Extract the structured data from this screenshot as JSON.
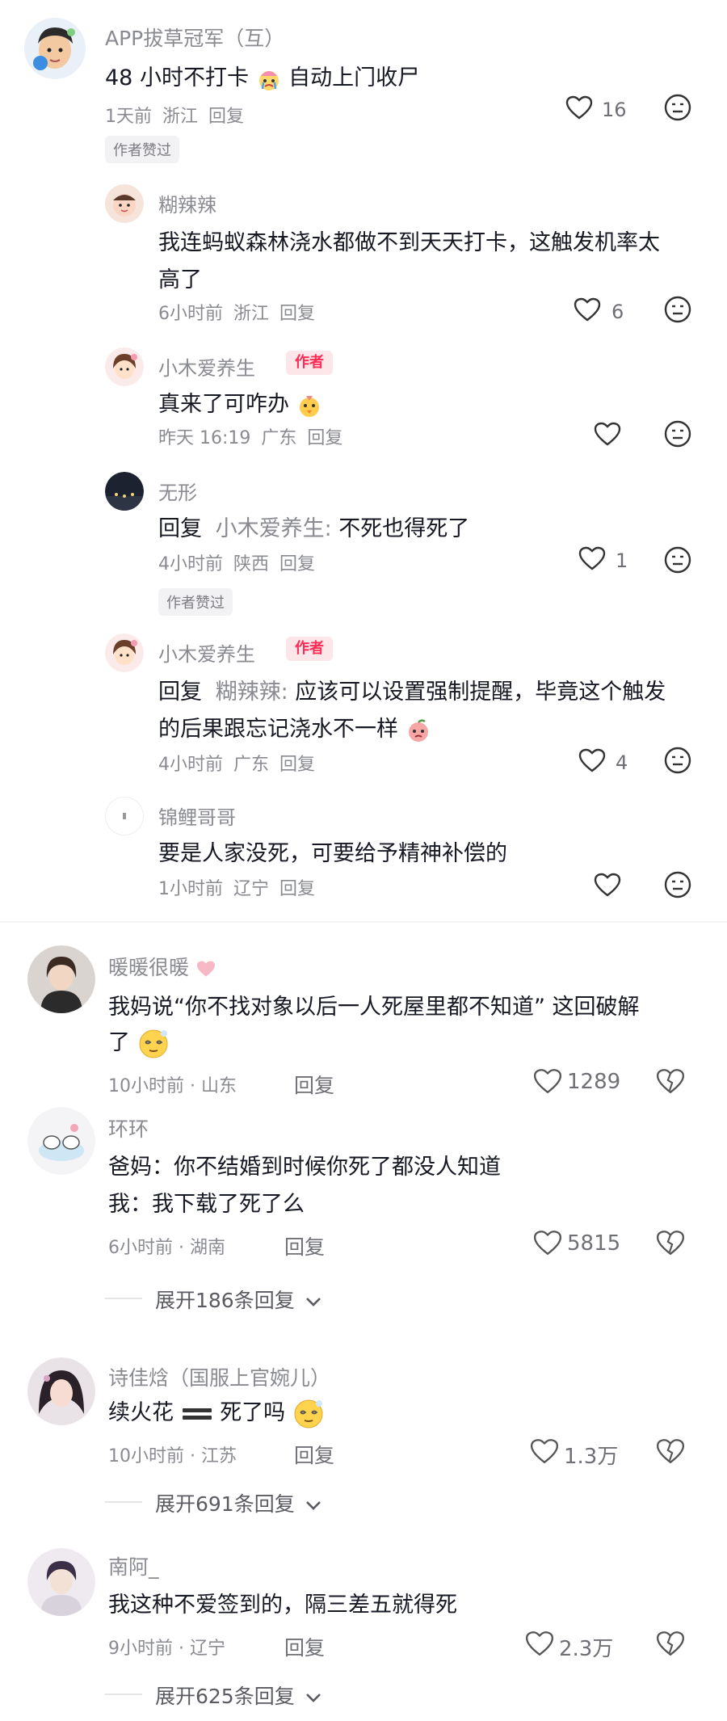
{
  "c1": {
    "name": "APP拔草冠军（互）",
    "text_a": "48 小时不打卡",
    "text_b": "自动上门收尸",
    "time": "1天前",
    "region": "浙江",
    "reply": "回复",
    "likes": "16",
    "badge": "作者赞过"
  },
  "r1": {
    "name": "糊辣辣",
    "line1": "我连蚂蚁森林浇水都做不到天天打卡，这触发机率太",
    "line2": "高了",
    "time": "6小时前",
    "region": "浙江",
    "reply": "回复",
    "likes": "6"
  },
  "r2": {
    "name": "小木爱养生",
    "tag": "作者",
    "text": "真来了可咋办",
    "time": "昨天 16:19",
    "region": "广东",
    "reply": "回复"
  },
  "r3": {
    "name": "无形",
    "prefix": "回复",
    "mention": "小木爱养生:",
    "text": "不死也得死了",
    "time": "4小时前",
    "region": "陕西",
    "reply": "回复",
    "likes": "1",
    "badge": "作者赞过"
  },
  "r4": {
    "name": "小木爱养生",
    "tag": "作者",
    "prefix": "回复",
    "mention": "糊辣辣:",
    "text1": "应该可以设置强制提醒，毕竟这个触发",
    "text2": "的后果跟忘记浇水不一样",
    "time": "4小时前",
    "region": "广东",
    "reply": "回复",
    "likes": "4"
  },
  "r5": {
    "name": "锦鲤哥哥",
    "text": "要是人家没死，可要给予精神补偿的",
    "time": "1小时前",
    "region": "辽宁",
    "reply": "回复"
  },
  "c2": {
    "name": "暖暖很暖",
    "line1": "我妈说“你不找对象以后一人死屋里都不知道” 这回破解",
    "line2": "了",
    "meta": "10小时前 · 山东",
    "reply": "回复",
    "likes": "1289"
  },
  "c3": {
    "name": "环环",
    "line1": "爸妈：你不结婚到时候你死了都没人知道",
    "line2": "我：我下载了死了么",
    "meta": "6小时前 · 湖南",
    "reply": "回复",
    "likes": "5815",
    "expand": "展开186条回复"
  },
  "c4": {
    "name": "诗佳焓（国服上官婉儿）",
    "text_a": "续火花",
    "text_b": "死了吗",
    "meta": "10小时前 · 江苏",
    "reply": "回复",
    "likes": "1.3万",
    "expand": "展开691条回复"
  },
  "c5": {
    "name": "南阿_",
    "text": "我这种不爱签到的，隔三差五就得死",
    "meta": "9小时前 · 辽宁",
    "reply": "回复",
    "likes": "2.3万",
    "expand": "展开625条回复"
  },
  "colors": {
    "text": "#161823",
    "muted": "#8a8b91",
    "author_tag_bg": "#fde6ea",
    "author_tag_fg": "#fe2c55",
    "badge_bg": "#f2f2f4"
  }
}
